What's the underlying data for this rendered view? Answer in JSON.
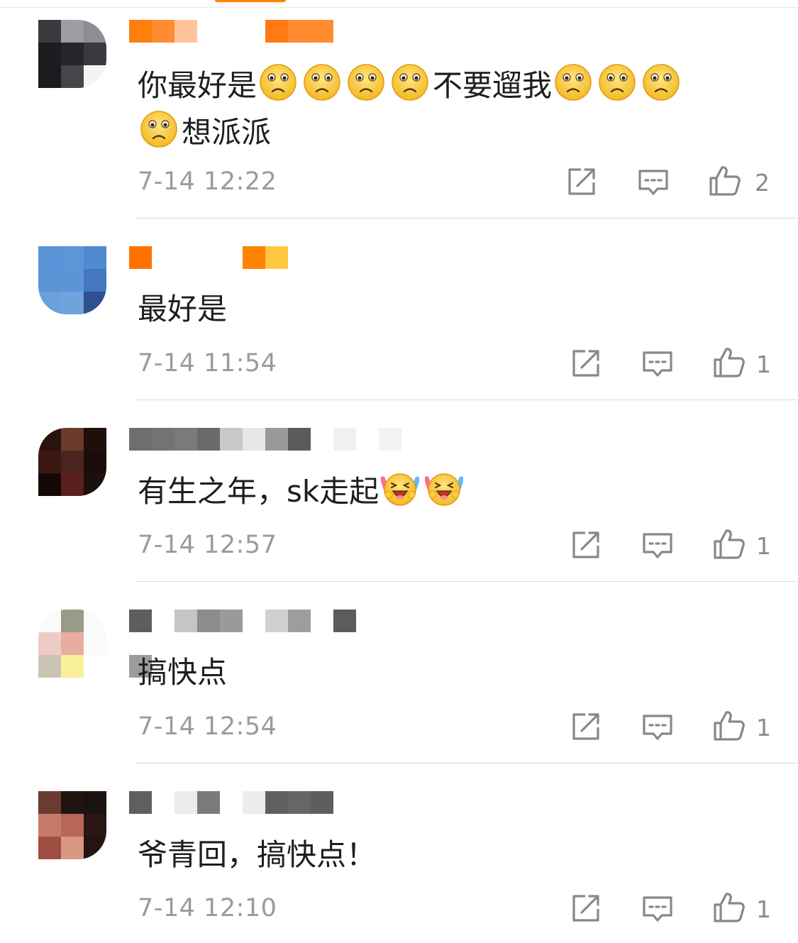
{
  "comments": [
    {
      "text": "你最好是",
      "text_tail": "不要遛我",
      "text_line2": "想派派",
      "emoji_before": 4,
      "emoji_after": 3,
      "emoji_line2": 1,
      "emoji_icon": "sad-tearful-face-icon",
      "time": "7-14 12:22",
      "likes": "2"
    },
    {
      "text": "最好是",
      "time": "7-14 11:54",
      "likes": "1"
    },
    {
      "text": "有生之年，sk走起",
      "emoji_icon": "cheering-face-icon",
      "emoji_count": 2,
      "time": "7-14 12:57",
      "likes": "1"
    },
    {
      "text": "搞快点",
      "time": "7-14 12:54",
      "likes": "1"
    },
    {
      "text": "爷青回，搞快点！",
      "time": "7-14 12:10",
      "likes": "1"
    }
  ],
  "colors": {
    "accent": "#ff8200",
    "text": "#1e1e1e",
    "meta": "#9b9b9b",
    "icon": "#888888",
    "divider": "#dcdcdc"
  },
  "icons": [
    "share-icon",
    "reply-icon",
    "like-icon"
  ]
}
